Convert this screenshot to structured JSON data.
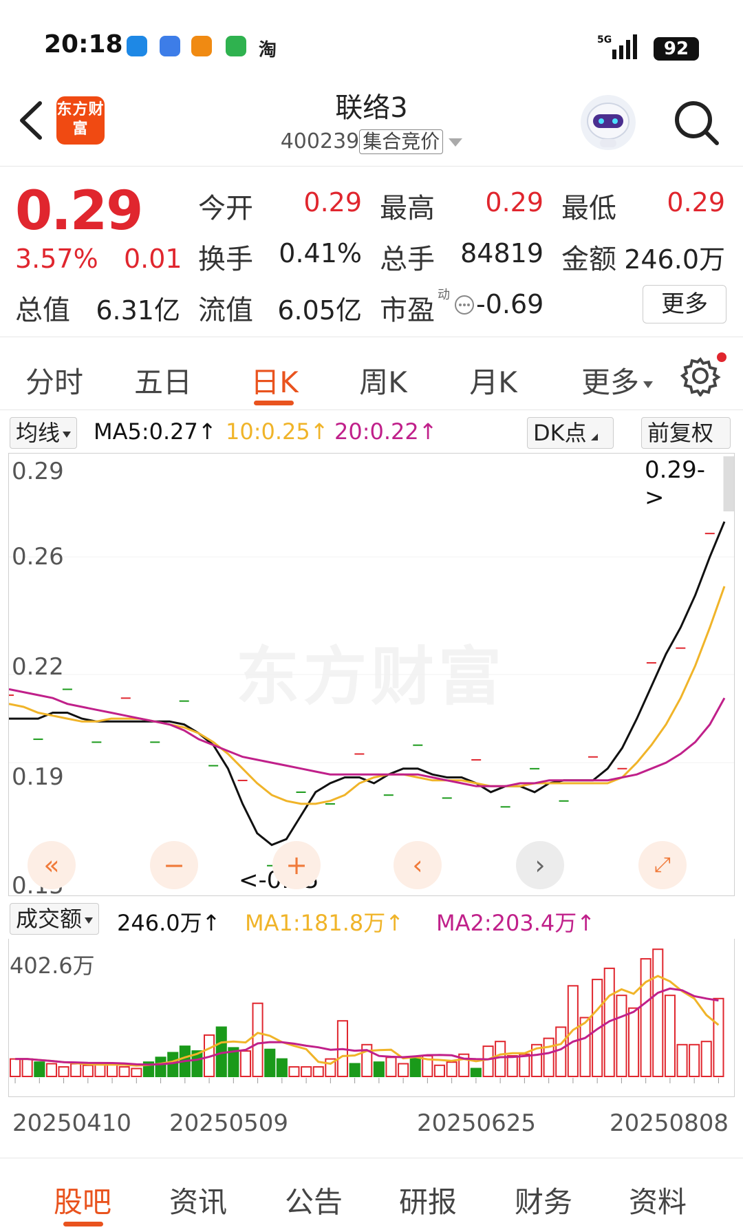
{
  "status_bar": {
    "time": "20:18",
    "network": "5G",
    "battery": "92",
    "app_icons": [
      "edge-icon",
      "browser-icon",
      "reader-icon",
      "security-icon",
      "taobao-icon"
    ],
    "taobao_label": "淘"
  },
  "header": {
    "logo_text": "东方财富",
    "stock_name": "联络3",
    "stock_code": "400239",
    "trade_mode": "集合竞价"
  },
  "quote": {
    "price": "0.29",
    "change_pct": "3.57%",
    "change": "0.01",
    "open_label": "今开",
    "open": "0.29",
    "high_label": "最高",
    "high": "0.29",
    "low_label": "最低",
    "low": "0.29",
    "turnover_label": "换手",
    "turnover": "0.41%",
    "volume_label": "总手",
    "volume": "84819",
    "amount_label": "金额",
    "amount": "246.0万",
    "mcap_label": "总值",
    "mcap": "6.31亿",
    "float_label": "流值",
    "float_mcap": "6.05亿",
    "pe_label": "市盈",
    "pe_sup": "动",
    "pe": "-0.69",
    "more_label": "更多"
  },
  "tabs": [
    {
      "label": "分时"
    },
    {
      "label": "五日"
    },
    {
      "label": "日K"
    },
    {
      "label": "周K"
    },
    {
      "label": "月K"
    },
    {
      "label": "更多"
    }
  ],
  "indicator": {
    "chip": "均线",
    "ma5": "MA5:0.27↑",
    "ma10": "10:0.25↑",
    "ma20": "20:0.22↑",
    "dk_label": "DK点",
    "adjust_label": "前复权"
  },
  "colors": {
    "up": "#e0262e",
    "down": "#1a9a1a",
    "ma5": "#111111",
    "ma10": "#f0b429",
    "ma20": "#c0208a",
    "accent": "#e9531e"
  },
  "chart_data": [
    {
      "type": "line",
      "y_tick_labels": [
        "0.29",
        "0.26",
        "0.22",
        "0.19",
        "0.15"
      ],
      "ylim": [
        0.15,
        0.29
      ],
      "latest_label": "0.29->",
      "min_label": "<-0.15",
      "series": [
        {
          "name": "MA5",
          "values": [
            0.205,
            0.205,
            0.205,
            0.207,
            0.207,
            0.205,
            0.204,
            0.204,
            0.204,
            0.204,
            0.204,
            0.204,
            0.203,
            0.2,
            0.196,
            0.188,
            0.176,
            0.166,
            0.162,
            0.164,
            0.172,
            0.18,
            0.183,
            0.185,
            0.185,
            0.183,
            0.186,
            0.188,
            0.188,
            0.186,
            0.185,
            0.185,
            0.183,
            0.18,
            0.182,
            0.182,
            0.18,
            0.183,
            0.184,
            0.184,
            0.184,
            0.188,
            0.195,
            0.205,
            0.216,
            0.227,
            0.236,
            0.247,
            0.26,
            0.272
          ]
        },
        {
          "name": "10",
          "values": [
            0.21,
            0.209,
            0.207,
            0.206,
            0.205,
            0.204,
            0.204,
            0.205,
            0.205,
            0.205,
            0.204,
            0.203,
            0.202,
            0.2,
            0.197,
            0.193,
            0.188,
            0.183,
            0.179,
            0.177,
            0.176,
            0.176,
            0.177,
            0.179,
            0.183,
            0.185,
            0.186,
            0.186,
            0.185,
            0.184,
            0.184,
            0.184,
            0.183,
            0.182,
            0.182,
            0.182,
            0.183,
            0.183,
            0.183,
            0.183,
            0.183,
            0.183,
            0.185,
            0.19,
            0.196,
            0.203,
            0.212,
            0.223,
            0.236,
            0.25
          ]
        },
        {
          "name": "20",
          "values": [
            0.215,
            0.214,
            0.213,
            0.212,
            0.21,
            0.209,
            0.208,
            0.207,
            0.206,
            0.205,
            0.204,
            0.203,
            0.201,
            0.198,
            0.196,
            0.194,
            0.192,
            0.191,
            0.19,
            0.189,
            0.188,
            0.187,
            0.186,
            0.186,
            0.186,
            0.186,
            0.186,
            0.186,
            0.186,
            0.185,
            0.184,
            0.183,
            0.182,
            0.182,
            0.182,
            0.183,
            0.183,
            0.184,
            0.184,
            0.184,
            0.184,
            0.184,
            0.185,
            0.186,
            0.188,
            0.19,
            0.193,
            0.197,
            0.203,
            0.212
          ]
        }
      ]
    },
    {
      "type": "bar",
      "max_label": "402.6万",
      "current": "246.0万↑",
      "ma1": "MA1:181.8万↑",
      "ma2": "MA2:203.4万↑",
      "ylim": [
        0,
        402.6
      ],
      "x_tick_labels": [
        "20250410",
        "20250509",
        "20250625",
        "20250808"
      ],
      "values": [
        55,
        55,
        45,
        40,
        30,
        40,
        35,
        40,
        40,
        30,
        25,
        45,
        60,
        75,
        95,
        80,
        130,
        155,
        90,
        80,
        230,
        85,
        55,
        30,
        30,
        30,
        55,
        175,
        40,
        100,
        45,
        60,
        40,
        60,
        65,
        35,
        45,
        70,
        25,
        95,
        110,
        65,
        70,
        100,
        120,
        155,
        285,
        185,
        305,
        340,
        255,
        215,
        370,
        400,
        255,
        100,
        100,
        110,
        245
      ],
      "up_or_down": [
        "u",
        "u",
        "d",
        "u",
        "u",
        "u",
        "u",
        "u",
        "u",
        "u",
        "u",
        "d",
        "d",
        "d",
        "d",
        "d",
        "u",
        "d",
        "d",
        "u",
        "u",
        "d",
        "d",
        "u",
        "u",
        "u",
        "u",
        "u",
        "d",
        "u",
        "d",
        "u",
        "u",
        "d",
        "u",
        "u",
        "u",
        "u",
        "d",
        "u",
        "u",
        "u",
        "u",
        "u",
        "u",
        "u",
        "u",
        "u",
        "u",
        "u",
        "u",
        "u",
        "u",
        "u",
        "u",
        "u",
        "u",
        "u",
        "u"
      ]
    }
  ],
  "vol_label": "成交额",
  "bottom_nav": [
    {
      "label": "股吧"
    },
    {
      "label": "资讯"
    },
    {
      "label": "公告"
    },
    {
      "label": "研报"
    },
    {
      "label": "财务"
    },
    {
      "label": "资料"
    }
  ],
  "watermark": "东方财富"
}
